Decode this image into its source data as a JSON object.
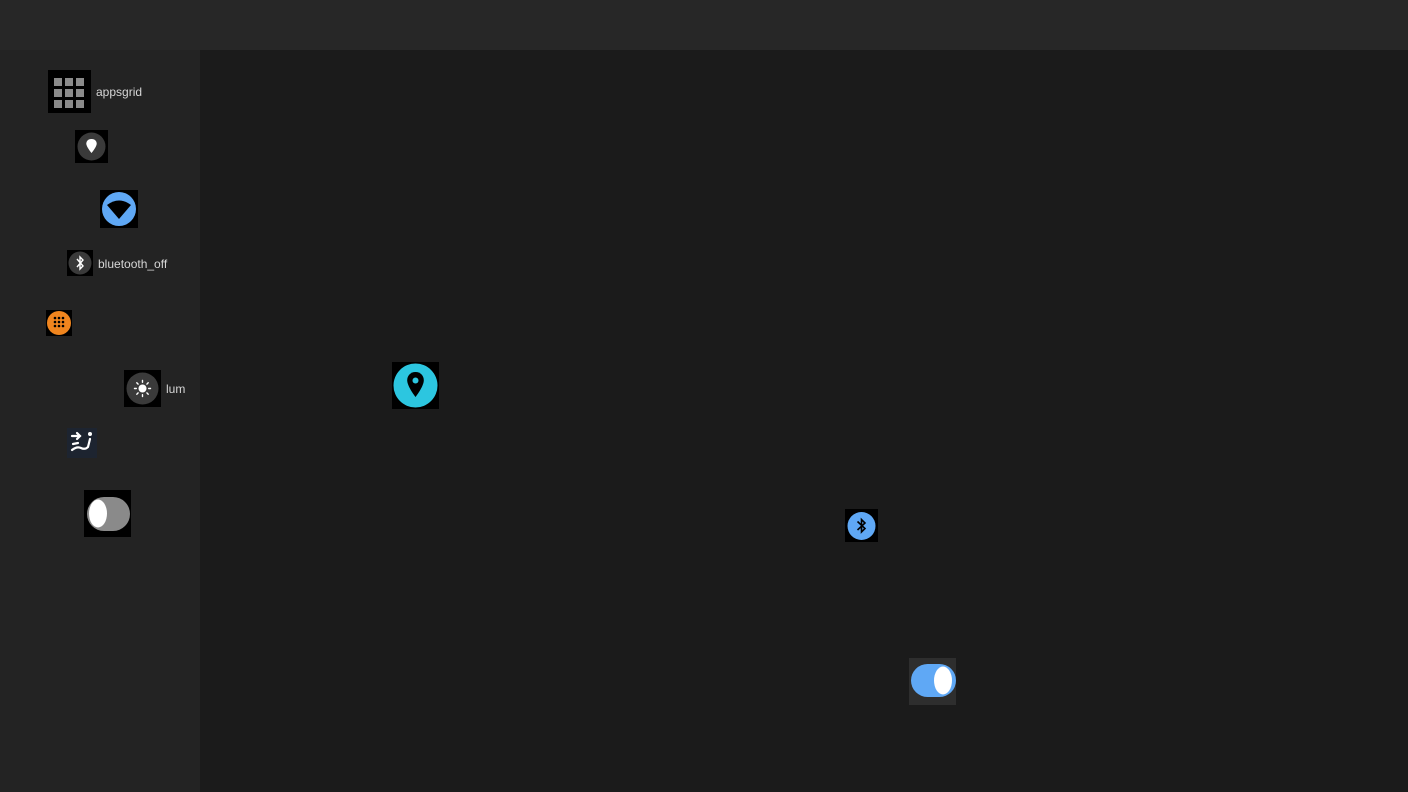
{
  "sidebar": {
    "items": [
      {
        "icon": "apps-grid-icon",
        "label": "appsgrid"
      },
      {
        "icon": "location-pin-icon",
        "label": ""
      },
      {
        "icon": "wifi-icon",
        "label": ""
      },
      {
        "icon": "bluetooth-off-icon",
        "label": "bluetooth_off"
      },
      {
        "icon": "dialpad-icon",
        "label": ""
      },
      {
        "icon": "brightness-icon",
        "label": "lum"
      },
      {
        "icon": "seat-recline-icon",
        "label": ""
      },
      {
        "icon": "toggle-off-icon",
        "label": ""
      }
    ]
  },
  "main": {
    "items": [
      {
        "icon": "location-pin-icon",
        "label": ""
      },
      {
        "icon": "bluetooth-on-icon",
        "label": ""
      },
      {
        "icon": "toggle-on-icon",
        "label": ""
      }
    ]
  },
  "colors": {
    "topbar": "#272727",
    "sidebar": "#232323",
    "canvas": "#1b1b1b",
    "blue_accent": "#5fa8f5",
    "cyan_accent": "#2cc6e0",
    "orange_accent": "#f0851e",
    "grey_icon": "#3a3a3a"
  }
}
